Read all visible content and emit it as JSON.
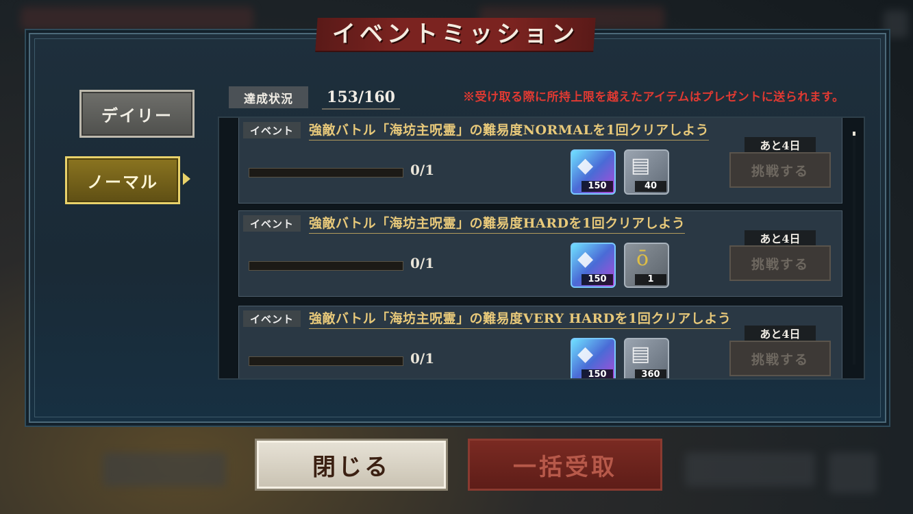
{
  "title": "イベントミッション",
  "tabs": {
    "daily": "デイリー",
    "normal": "ノーマル"
  },
  "status": {
    "label": "達成状況",
    "value": "153/160"
  },
  "notice": "※受け取る際に所持上限を越えたアイテムはプレゼントに送られます。",
  "missions": [
    {
      "category": "イベント",
      "title": "強敵バトル「海坊主呪霊」の難易度NORMALを1回クリアしよう",
      "progress": "0/1",
      "progress_fraction": 0,
      "rewards": [
        {
          "icon": "gem-cube-icon",
          "qty": "150"
        },
        {
          "icon": "scroll-icon",
          "qty": "40"
        }
      ],
      "deadline": "あと4日",
      "button": "挑戦する"
    },
    {
      "category": "イベント",
      "title": "強敵バトル「海坊主呪霊」の難易度HARDを1回クリアしよう",
      "progress": "0/1",
      "progress_fraction": 0,
      "rewards": [
        {
          "icon": "gem-cube-icon",
          "qty": "150"
        },
        {
          "icon": "gold-medal-icon",
          "qty": "1"
        }
      ],
      "deadline": "あと4日",
      "button": "挑戦する"
    },
    {
      "category": "イベント",
      "title": "強敵バトル「海坊主呪霊」の難易度VERY HARDを1回クリアしよう",
      "progress": "0/1",
      "progress_fraction": 0,
      "rewards": [
        {
          "icon": "gem-cube-icon",
          "qty": "150"
        },
        {
          "icon": "scroll-icon",
          "qty": "360"
        }
      ],
      "deadline": "あと4日",
      "button": "挑戦する"
    }
  ],
  "buttons": {
    "close": "閉じる",
    "bulk_receive": "一括受取"
  }
}
